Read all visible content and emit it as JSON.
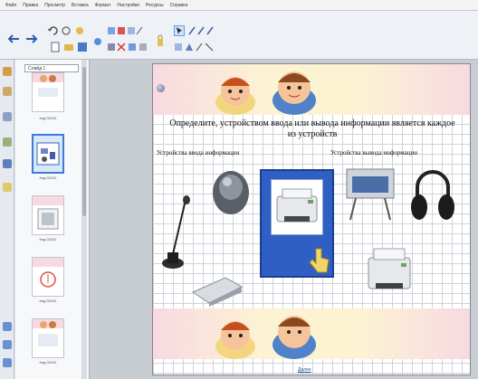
{
  "menubar": {
    "items": [
      "Файл",
      "Правка",
      "Просмотр",
      "Вставка",
      "Формат",
      "Настройки",
      "Ресурсы",
      "Справка"
    ]
  },
  "slide_sorter": {
    "header": "Слайд 1",
    "thumbnails": [
      {
        "label": "Img 02101"
      },
      {
        "label": "Img 02101",
        "active": true
      },
      {
        "label": "Img 02101"
      },
      {
        "label": "Img 02101"
      },
      {
        "label": "Img 02101"
      }
    ]
  },
  "slide": {
    "title": "Определите, устройством ввода или вывода информации является каждое из устройств",
    "input_label": "Устройства ввода информации",
    "output_label": "Устройства вывода информации",
    "footer_link": "Далее"
  },
  "colors": {
    "accent": "#3d7bd6",
    "box_blue": "#2f5fc4"
  },
  "icons": [
    "back-arrow-icon",
    "forward-arrow-icon",
    "undo-icon",
    "redo-icon",
    "select-arrow-icon",
    "pen-icon",
    "eraser-icon",
    "shapes-icon",
    "text-icon",
    "lock-icon"
  ]
}
